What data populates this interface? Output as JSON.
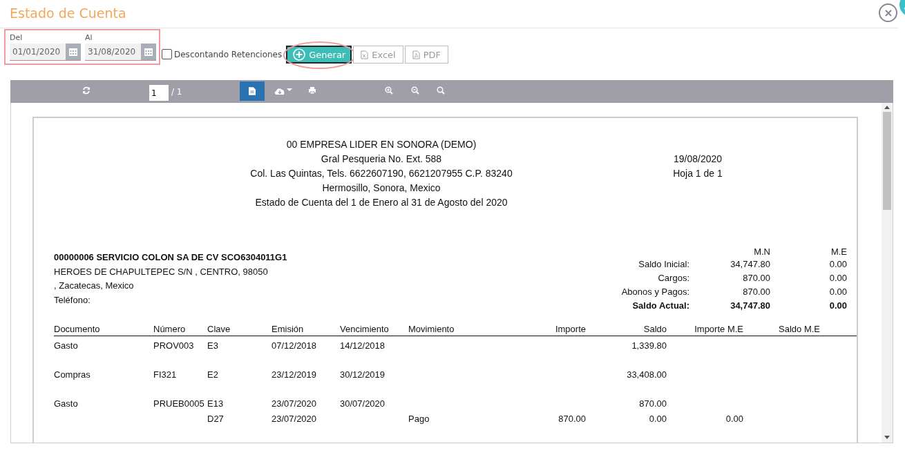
{
  "title": "Estado de Cuenta",
  "filters": {
    "from": {
      "label": "Del",
      "value": "01/01/2020"
    },
    "to": {
      "label": "Al",
      "value": "31/08/2020"
    },
    "discount_withholdings": {
      "label": "Descontando Retenciones",
      "checked": false
    }
  },
  "buttons": [
    {
      "label": "Generar",
      "kind": "primary",
      "highlighted": true
    },
    {
      "label": "Excel",
      "kind": "excel",
      "highlighted": false
    },
    {
      "label": "PDF",
      "kind": "pdf",
      "highlighted": false
    }
  ],
  "viewer": {
    "page": "1",
    "page_count": "/ 1"
  },
  "report": {
    "header_lines": [
      "00 EMPRESA LIDER EN SONORA (DEMO)",
      "Gral Pesqueria No. Ext. 588",
      "Col. Las Quintas, Tels. 6622607190, 6621207955 C.P. 83240",
      "Hermosillo, Sonora, Mexico",
      "Estado de Cuenta del 1 de Enero al 31 de Agosto del 2020"
    ],
    "date": "19/08/2020",
    "page_info": "Hoja 1 de 1",
    "customer": {
      "name": "00000006 SERVICIO COLON SA DE CV SCO6304011G1",
      "lines": [
        "HEROES DE CHAPULTEPEC S/N , CENTRO, 98050",
        ", Zacatecas, Mexico",
        "Teléfono:"
      ]
    },
    "summary": {
      "columns": [
        "M.N",
        "M.E"
      ],
      "rows": [
        {
          "label": "Saldo Inicial:",
          "values": [
            "34,747.80",
            "0.00"
          ],
          "bold": false
        },
        {
          "label": "Cargos:",
          "values": [
            "870.00",
            "0.00"
          ],
          "bold": false
        },
        {
          "label": "Abonos y Pagos:",
          "values": [
            "870.00",
            "0.00"
          ],
          "bold": false
        },
        {
          "label": "Saldo Actual:",
          "values": [
            "34,747.80",
            "0.00"
          ],
          "bold": true
        }
      ]
    },
    "table": {
      "columns": [
        "Documento",
        "Número",
        "Clave",
        "Emisión",
        "Vencimiento",
        "Movimiento",
        "Importe",
        "Saldo",
        "Importe M.E",
        "Saldo M.E"
      ],
      "groups": [
        {
          "rows": [
            [
              "Gasto",
              "PROV003",
              "E3",
              "07/12/2018",
              "14/12/2018",
              "",
              "",
              "1,339.80",
              "",
              ""
            ]
          ]
        },
        {
          "rows": [
            [
              "Compras",
              "FI321",
              "E2",
              "23/12/2019",
              "30/12/2019",
              "",
              "",
              "33,408.00",
              "",
              ""
            ]
          ]
        },
        {
          "rows": [
            [
              "Gasto",
              "PRUEB0005",
              "E13",
              "23/07/2020",
              "30/07/2020",
              "",
              "",
              "870.00",
              "",
              ""
            ],
            [
              "",
              "",
              "D27",
              "23/07/2020",
              "",
              "Pago",
              "870.00",
              "0.00",
              "0.00",
              ""
            ]
          ]
        }
      ]
    }
  }
}
